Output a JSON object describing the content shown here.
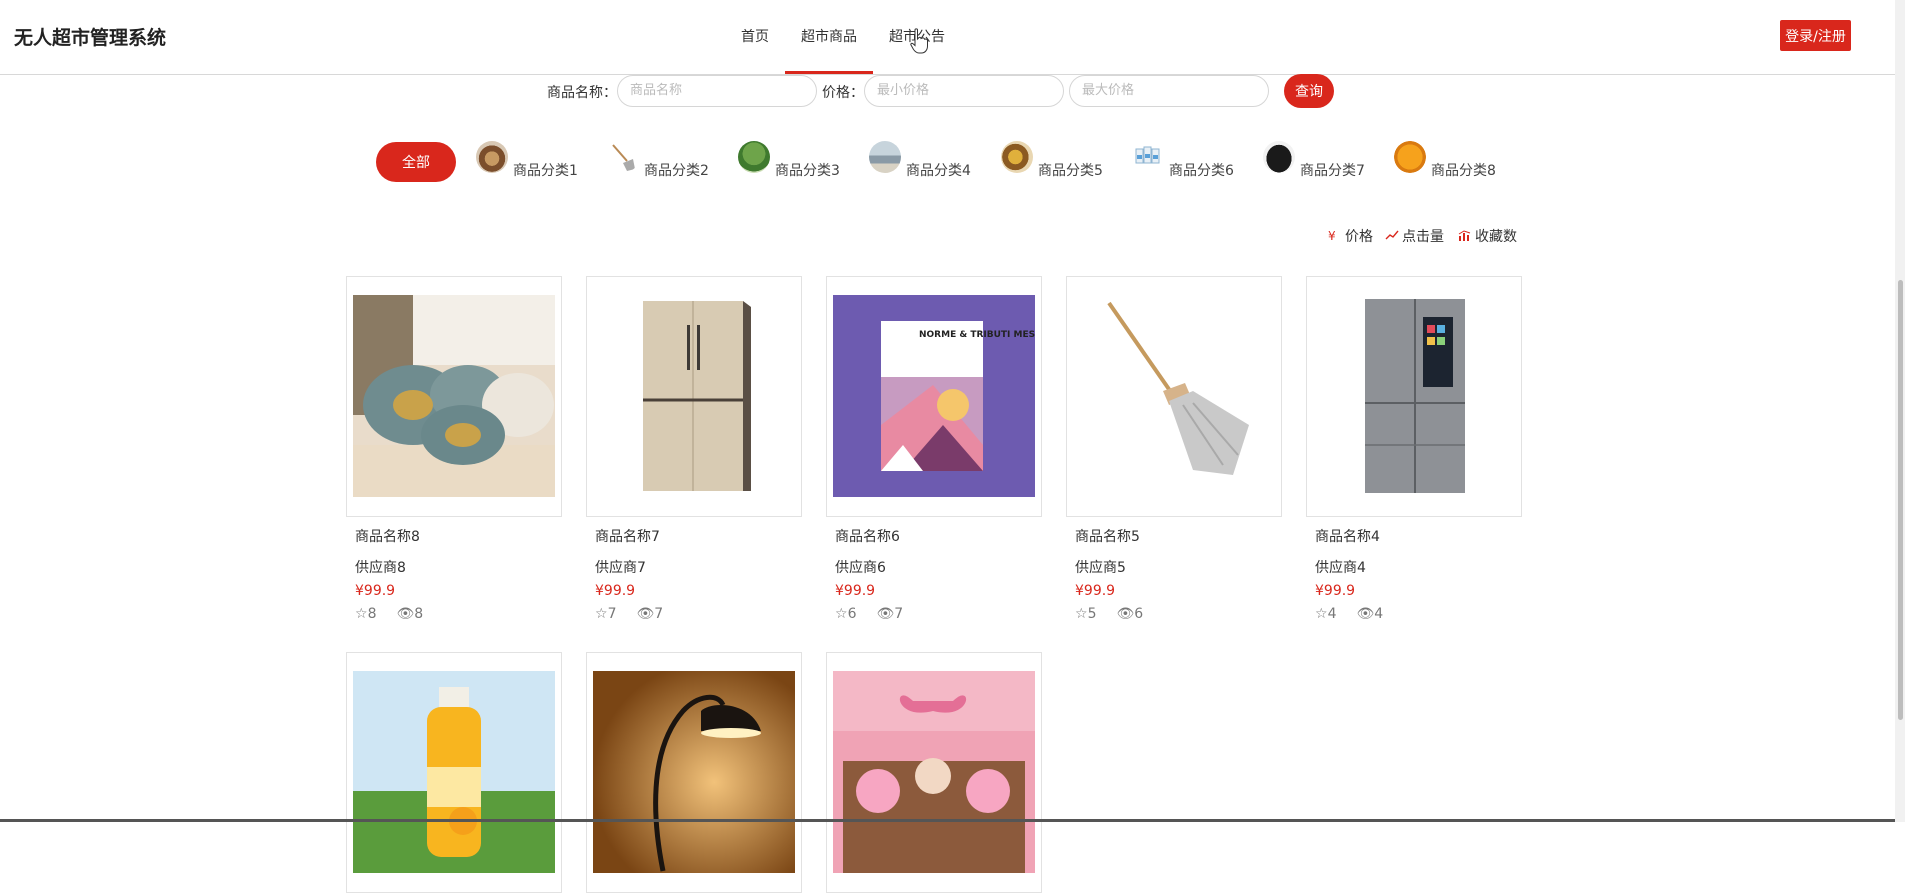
{
  "header": {
    "title": "无人超市管理系统",
    "nav": [
      "首页",
      "超市商品",
      "超市公告"
    ],
    "login": "登录/注册"
  },
  "search": {
    "name_label": "商品名称：",
    "name_placeholder": "商品名称",
    "price_label": "价格：",
    "min_placeholder": "最小价格",
    "max_placeholder": "最大价格",
    "button": "查询"
  },
  "categories": {
    "all": "全部",
    "items": [
      "商品分类1",
      "商品分类2",
      "商品分类3",
      "商品分类4",
      "商品分类5",
      "商品分类6",
      "商品分类7",
      "商品分类8"
    ]
  },
  "sort": {
    "price": "价格",
    "clicks": "点击量",
    "favorites": "收藏数"
  },
  "products": [
    {
      "name": "商品名称8",
      "supplier": "供应商8",
      "price": "¥99.9",
      "favorites": "8",
      "views": "8"
    },
    {
      "name": "商品名称7",
      "supplier": "供应商7",
      "price": "¥99.9",
      "favorites": "7",
      "views": "7"
    },
    {
      "name": "商品名称6",
      "supplier": "供应商6",
      "price": "¥99.9",
      "favorites": "6",
      "views": "7",
      "book_text": "NORME & TRIBUTI MESE"
    },
    {
      "name": "商品名称5",
      "supplier": "供应商5",
      "price": "¥99.9",
      "favorites": "5",
      "views": "6"
    },
    {
      "name": "商品名称4",
      "supplier": "供应商4",
      "price": "¥99.9",
      "favorites": "4",
      "views": "4"
    }
  ],
  "colors": {
    "accent": "#d9271c"
  }
}
